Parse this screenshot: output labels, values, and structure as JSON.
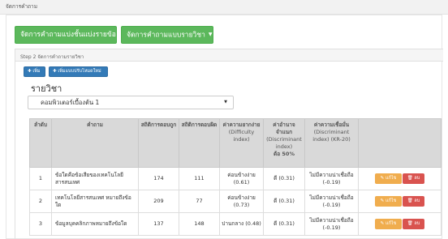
{
  "topbar": {
    "title": "จัดการคำถาม"
  },
  "buttons": {
    "manage_by_part": "จัดการคำถามแบ่งชั้นแบ่งรายข้อ",
    "manage_by_subject": "จัดการคำถามแบบรายวิชา",
    "add": "เพิ่ม",
    "update_new": "เพิ่มแบบปรับโหมดใหม่"
  },
  "step": {
    "title": "Step 2 จัดการคำถามรายวิชา"
  },
  "subject": {
    "heading": "รายวิชา",
    "selected": "คอมพิวเตอร์เบื้องต้น 1"
  },
  "table": {
    "headers": {
      "no": "ลำดับ",
      "question": "คำถาม",
      "correct": "สถิติการตอบถูก",
      "wrong": "สถิติการตอบผิด",
      "difficulty": "ค่าความยากง่าย",
      "difficulty_sub": "(Difficulty index)",
      "discrimination": "ค่าอำนาจจำแนก",
      "discrimination_sub": "(Discriminant index)",
      "discrimination_note": "ต้อ 50%",
      "reliability": "ค่าความเชื่อมั่น",
      "reliability_sub": "(Discriminant index) (KR-20)",
      "actions": ""
    },
    "rows": [
      {
        "no": "1",
        "question": "ข้อใดคือข้อเสียของเทคโนโลยีสารสนเทศ",
        "correct": "174",
        "wrong": "111",
        "difficulty": "ค่อนข้างง่าย (0.61)",
        "discrimination": "ดี (0.31)",
        "reliability": "ไม่มีความน่าเชื่อถือ (-0.19)",
        "edit": "แก้ไข",
        "delete": "ลบ"
      },
      {
        "no": "2",
        "question": "เทคโนโลยีสารสนเทศ หมายถึงข้อใด",
        "correct": "209",
        "wrong": "77",
        "difficulty": "ค่อนข้างง่าย (0.73)",
        "discrimination": "ดี (0.31)",
        "reliability": "ไม่มีความน่าเชื่อถือ (-0.19)",
        "edit": "แก้ไข",
        "delete": "ลบ"
      },
      {
        "no": "3",
        "question": "ข้อมูลบุคคลิกภาพหมายถึงข้อใด",
        "correct": "137",
        "wrong": "148",
        "difficulty": "ปานกลาง (0.48)",
        "discrimination": "ดี (0.31)",
        "reliability": "ไม่มีความน่าเชื่อถือ (-0.19)",
        "edit": "แก้ไข",
        "delete": "ลบ"
      }
    ]
  },
  "icons": {
    "add": "plus-icon",
    "update": "plus-icon",
    "edit": "pencil-icon",
    "delete": "trash-icon",
    "dropdown": "caret-down-icon"
  },
  "colors": {
    "green": "#5cb85c",
    "blue": "#337ab7",
    "orange": "#f0ad4e",
    "red": "#d9534f"
  }
}
